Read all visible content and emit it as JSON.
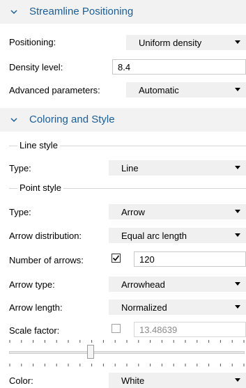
{
  "streamline_positioning": {
    "title": "Streamline Positioning",
    "positioning": {
      "label": "Positioning:",
      "value": "Uniform density"
    },
    "density_level": {
      "label": "Density level:",
      "value": "8.4"
    },
    "advanced_parameters": {
      "label": "Advanced parameters:",
      "value": "Automatic"
    }
  },
  "coloring_and_style": {
    "title": "Coloring and Style",
    "line_style": {
      "group_label": "Line style",
      "type": {
        "label": "Type:",
        "value": "Line"
      }
    },
    "point_style": {
      "group_label": "Point style",
      "type": {
        "label": "Type:",
        "value": "Arrow"
      },
      "arrow_distribution": {
        "label": "Arrow distribution:",
        "value": "Equal arc length"
      },
      "number_of_arrows": {
        "label": "Number of arrows:",
        "checked": true,
        "value": "120"
      },
      "arrow_type": {
        "label": "Arrow type:",
        "value": "Arrowhead"
      },
      "arrow_length": {
        "label": "Arrow length:",
        "value": "Normalized"
      },
      "scale_factor": {
        "label": "Scale factor:",
        "checked": false,
        "value": "13.48639",
        "slider_position": 0.34
      }
    },
    "color": {
      "label": "Color:",
      "value": "White"
    }
  },
  "colors": {
    "section_title": "#1a5e9a",
    "section_bg": "#f2f2f2",
    "dropdown_bg": "#f0f0f0"
  },
  "icons": {
    "section_chevron": "chevron-down-icon",
    "checkbox_checked": "checkmark-icon",
    "dropdown_arrow": "dropdown-arrow-icon"
  }
}
